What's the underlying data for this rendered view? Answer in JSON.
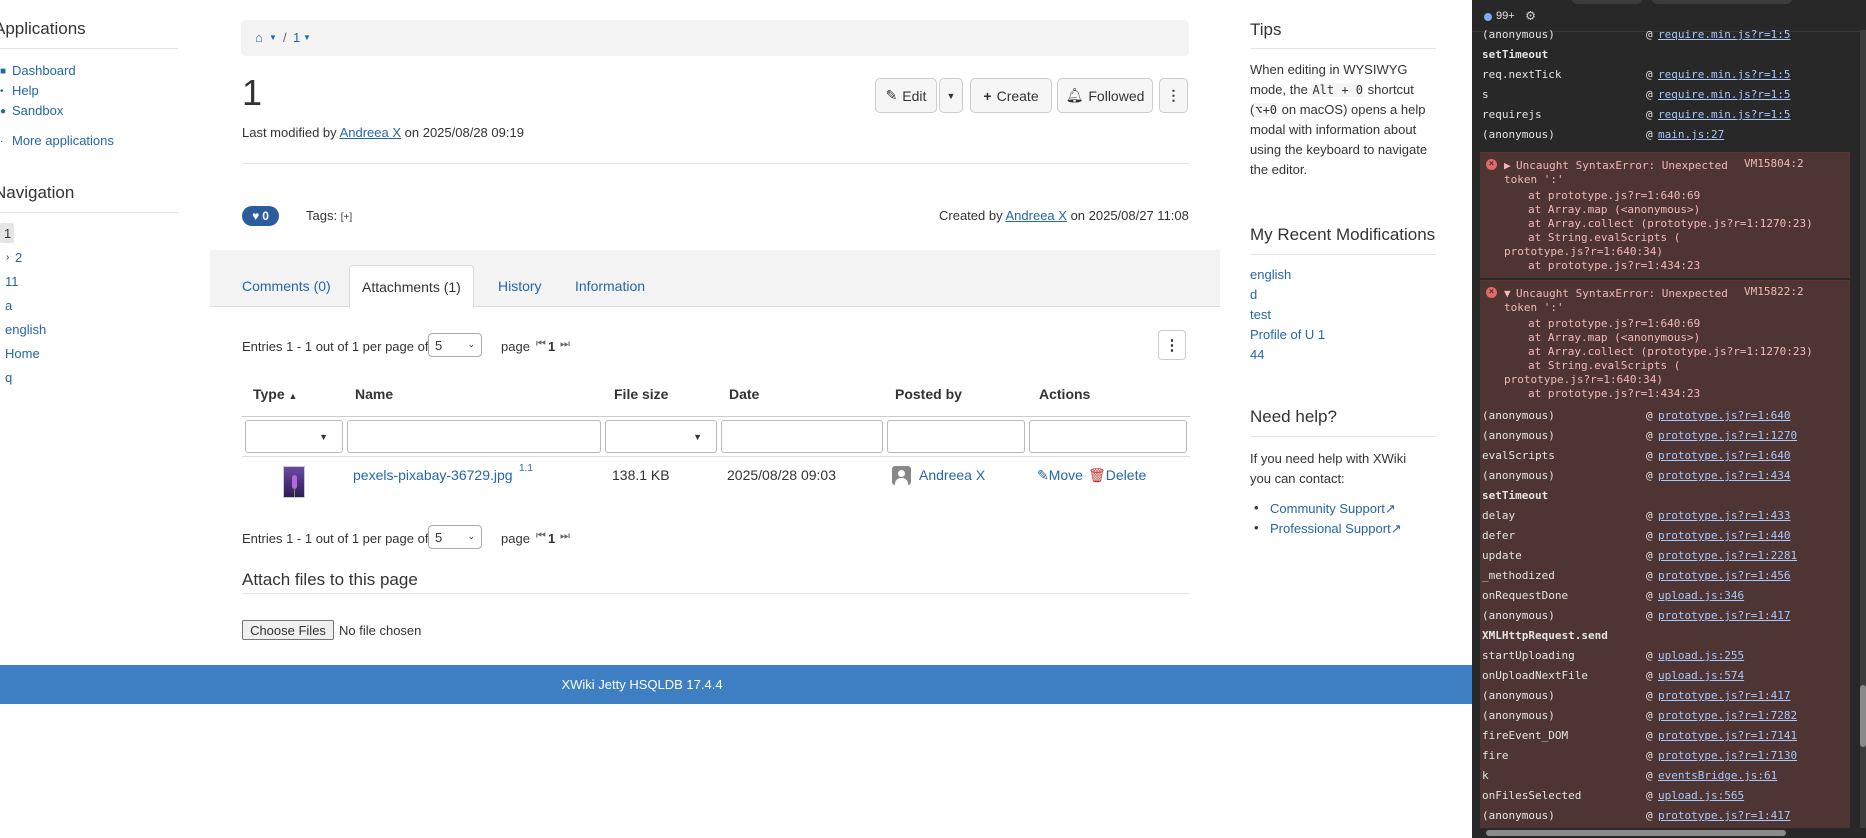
{
  "left_panel": {
    "applications_heading": "Applications",
    "applications": [
      {
        "label": "Dashboard"
      },
      {
        "label": "Help"
      },
      {
        "label": "Sandbox"
      }
    ],
    "more_applications": "More applications",
    "navigation_heading": "Navigation",
    "navigation": [
      "1",
      "2",
      "11",
      "a",
      "english",
      "Home",
      "q"
    ]
  },
  "breadcrumb": {
    "current": "1"
  },
  "page": {
    "title": "1",
    "last_modified_prefix": "Last modified by",
    "last_modified_user": "Andreea X",
    "last_modified_suffix": "on 2025/08/28 09:19",
    "likes": "0",
    "tags_label": "Tags:",
    "tags_add": "[+]",
    "created_prefix": "Created by",
    "created_user": "Andreea X",
    "created_suffix": "on 2025/08/27 11:08"
  },
  "actions": {
    "edit": "Edit",
    "create": "Create",
    "followed": "Followed"
  },
  "tabs": [
    {
      "label": "Comments (0)"
    },
    {
      "label": "Attachments (1)"
    },
    {
      "label": "History"
    },
    {
      "label": "Information"
    }
  ],
  "attachments": {
    "entries_text": "Entries 1 - 1 out of 1 per page of",
    "per_page": "5",
    "page_label": "page",
    "page_num": "1",
    "columns": [
      "Type",
      "Name",
      "File size",
      "Date",
      "Posted by",
      "Actions"
    ],
    "rows": [
      {
        "name": "pexels-pixabay-36729.jpg",
        "version": "1.1",
        "size": "138.1 KB",
        "date": "2025/08/28 09:03",
        "posted_by": "Andreea X",
        "move": "Move",
        "delete": "Delete"
      }
    ],
    "attach_heading": "Attach files to this page",
    "choose_files": "Choose Files",
    "no_file": "No file chosen"
  },
  "footer": "XWiki Jetty HSQLDB 17.4.4",
  "right_panel": {
    "tips_heading": "Tips",
    "tips_text_1": "When editing in WYSIWYG mode, the",
    "tips_kbd": "Alt + 0",
    "tips_text_2": "shortcut (",
    "tips_kbd2": "⌥+0",
    "tips_text_3": "on macOS) opens a help modal with information about using the keyboard to navigate the editor.",
    "recent_heading": "My Recent Modifications",
    "recent": [
      "english",
      "d",
      "test",
      "Profile of U 1",
      "44"
    ],
    "help_heading": "Need help?",
    "help_text": "If you need help with XWiki you can contact:",
    "support": [
      "Community Support",
      "Professional Support"
    ]
  },
  "devtools": {
    "badge": "99+",
    "top_frames": [
      {
        "fn": "(anonymous)",
        "file": "require.min.js?r=1:5"
      },
      {
        "fn": "setTimeout",
        "file": ""
      },
      {
        "fn": "req.nextTick",
        "file": "require.min.js?r=1:5"
      },
      {
        "fn": "s",
        "file": "require.min.js?r=1:5"
      },
      {
        "fn": "requirejs",
        "file": "require.min.js?r=1:5"
      },
      {
        "fn": "(anonymous)",
        "file": "main.js:27"
      }
    ],
    "error1": {
      "msg": "Uncaught SyntaxError: Unexpected",
      "token": "token ':'",
      "src": "VM15804:2",
      "lines": [
        "at prototype.js?r=1:640:69",
        "at Array.map (<anonymous>)",
        "at Array.collect (prototype.js?r=1:1270:23)",
        "at String.evalScripts (",
        "prototype.js?r=1:640:34)",
        "at prototype.js?r=1:434:23"
      ]
    },
    "error2": {
      "msg": "Uncaught SyntaxError: Unexpected",
      "token": "token ':'",
      "src": "VM15822:2",
      "lines": [
        "at prototype.js?r=1:640:69",
        "at Array.map (<anonymous>)",
        "at Array.collect (prototype.js?r=1:1270:23)",
        "at String.evalScripts (",
        "prototype.js?r=1:640:34)",
        "at prototype.js?r=1:434:23"
      ]
    },
    "stack": [
      {
        "fn": "(anonymous)",
        "file": "prototype.js?r=1:640"
      },
      {
        "fn": "(anonymous)",
        "file": "prototype.js?r=1:1270"
      },
      {
        "fn": "evalScripts",
        "file": "prototype.js?r=1:640"
      },
      {
        "fn": "(anonymous)",
        "file": "prototype.js?r=1:434"
      },
      {
        "fn": "setTimeout",
        "file": ""
      },
      {
        "fn": "delay",
        "file": "prototype.js?r=1:433"
      },
      {
        "fn": "defer",
        "file": "prototype.js?r=1:440"
      },
      {
        "fn": "update",
        "file": "prototype.js?r=1:2281"
      },
      {
        "fn": "_methodized",
        "file": "prototype.js?r=1:456"
      },
      {
        "fn": "onRequestDone",
        "file": "upload.js:346"
      },
      {
        "fn": "(anonymous)",
        "file": "prototype.js?r=1:417"
      },
      {
        "fn": "XMLHttpRequest.send",
        "file": ""
      },
      {
        "fn": "startUploading",
        "file": "upload.js:255"
      },
      {
        "fn": "onUploadNextFile",
        "file": "upload.js:574"
      },
      {
        "fn": "(anonymous)",
        "file": "prototype.js?r=1:417"
      },
      {
        "fn": "(anonymous)",
        "file": "prototype.js?r=1:7282"
      },
      {
        "fn": "fireEvent_DOM",
        "file": "prototype.js?r=1:7141"
      },
      {
        "fn": "fire",
        "file": "prototype.js?r=1:7130"
      },
      {
        "fn": "k",
        "file": "eventsBridge.js:61"
      },
      {
        "fn": "onFilesSelected",
        "file": "upload.js:565"
      },
      {
        "fn": "(anonymous)",
        "file": "prototype.js?r=1:417"
      }
    ]
  },
  "colors": {
    "link": "#2566a6",
    "footer": "#3e7ec2",
    "like_badge": "#2b5d9c",
    "devtools_bg": "#282828",
    "error_bg": "#4e3534"
  }
}
